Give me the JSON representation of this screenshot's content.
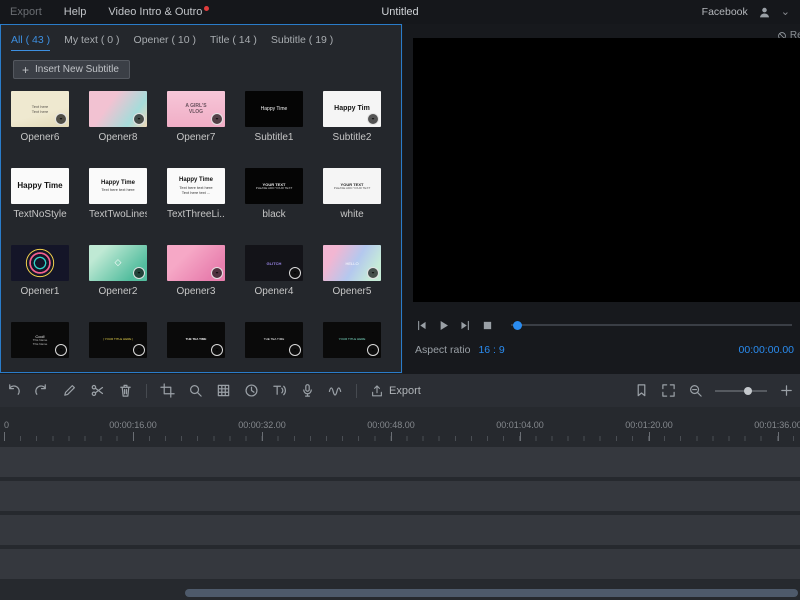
{
  "window": {
    "title": "Untitled"
  },
  "menubar": {
    "export": "Export",
    "help": "Help",
    "intro_outro": "Video Intro & Outro",
    "facebook": "Facebook"
  },
  "library": {
    "tabs": [
      {
        "label": "All ( 43 )",
        "active": true
      },
      {
        "label": "My text ( 0 )",
        "active": false
      },
      {
        "label": "Opener ( 10 )",
        "active": false
      },
      {
        "label": "Title ( 14 )",
        "active": false
      },
      {
        "label": "Subtitle ( 19 )",
        "active": false
      }
    ],
    "insert_button": "Insert New Subtitle",
    "templates": [
      {
        "label": "Opener6",
        "bg": "linear-gradient(165deg,#efe9d0 60%,#e3d9b6)",
        "lines": [
          {
            "t": "Text here",
            "c": "#55504a",
            "s": 4
          },
          {
            "t": "Text here",
            "c": "#55504a",
            "s": 4
          }
        ],
        "dl": true
      },
      {
        "label": "Opener8",
        "bg": "linear-gradient(125deg,#f2c2d2 35%,#a6dcda 75%,#f0d8b8)",
        "lines": [],
        "dl": true
      },
      {
        "label": "Opener7",
        "bg": "linear-gradient(180deg,#f7c6d8,#f0aec6)",
        "lines": [
          {
            "t": "A GIRL'S",
            "c": "#6a525e",
            "s": 5,
            "b": true
          },
          {
            "t": "VLOG",
            "c": "#6a525e",
            "s": 5,
            "b": true
          }
        ],
        "dl": true
      },
      {
        "label": "Subtitle1",
        "bg": "#050505",
        "lines": [
          {
            "t": "Happy Time",
            "c": "#f0f0f0",
            "s": 5
          }
        ],
        "dl": false
      },
      {
        "label": "Subtitle2",
        "bg": "#f5f5f5",
        "lines": [
          {
            "t": "Happy Tim",
            "c": "#111111",
            "s": 7,
            "b": true
          }
        ],
        "dl": true
      },
      {
        "label": "TextNoStyle",
        "bg": "#fafafa",
        "lines": [
          {
            "t": "Happy Time",
            "c": "#111111",
            "s": 8,
            "b": true
          }
        ],
        "dl": false
      },
      {
        "label": "TextTwoLines",
        "bg": "#fafafa",
        "lines": [
          {
            "t": "Happy Time",
            "c": "#111111",
            "s": 6,
            "b": true
          },
          {
            "t": "Text here text here",
            "c": "#333333",
            "s": 4
          }
        ],
        "dl": false
      },
      {
        "label": "TextThreeLi...",
        "bg": "#fafafa",
        "lines": [
          {
            "t": "Happy Time",
            "c": "#111111",
            "s": 6,
            "b": true
          },
          {
            "t": "Text here text here",
            "c": "#333333",
            "s": 4
          },
          {
            "t": "Text here text ...",
            "c": "#333333",
            "s": 4
          }
        ],
        "dl": false
      },
      {
        "label": "black",
        "bg": "#050505",
        "lines": [
          {
            "t": "YOUR TEXT",
            "c": "#f0f0f0",
            "s": 4,
            "b": true
          },
          {
            "t": "PLEASE ADD YOUR TEXT",
            "c": "#cfcfcf",
            "s": 3
          }
        ],
        "dl": false
      },
      {
        "label": "white",
        "bg": "#f5f5f5",
        "lines": [
          {
            "t": "YOUR TEXT",
            "c": "#222222",
            "s": 4,
            "b": true
          },
          {
            "t": "PLEASE ADD YOUR TEXT",
            "c": "#555555",
            "s": 3
          }
        ],
        "dl": false
      },
      {
        "label": "Opener1",
        "bg": "radial-gradient(circle at 50% 50%,#141528 0 14%,#2fd3c6 15% 18%,#141528 19% 26%,#f2608e 27% 31%,#141528 32% 38%,#e8c84a 39% 41%,#141528 42%)",
        "lines": [],
        "dl": false
      },
      {
        "label": "Opener2",
        "bg": "linear-gradient(135deg,#bfe9d4 20%,#53bd9e 80%)",
        "lines": [
          {
            "t": "◇",
            "c": "#ffffff",
            "s": 9
          }
        ],
        "dl": true
      },
      {
        "label": "Opener3",
        "bg": "linear-gradient(135deg,#f6a8c6 30%,#e87fae 80%)",
        "lines": [],
        "dl": true
      },
      {
        "label": "Opener4",
        "bg": "#131318",
        "lines": [
          {
            "t": "GLITCH",
            "c": "#9a86e8",
            "s": 4,
            "b": true
          }
        ],
        "dl": true
      },
      {
        "label": "Opener5",
        "bg": "linear-gradient(120deg,#f2b6d2 20%,#b4c8ee 55%,#c6ecd8 85%)",
        "lines": [
          {
            "t": "HELLO",
            "c": "#ffffff",
            "s": 4
          }
        ],
        "dl": true
      },
      {
        "label": "",
        "bg": "#0a0a0a",
        "lines": [
          {
            "t": "Cool!",
            "c": "#f0f0f0",
            "s": 4
          },
          {
            "t": "This Name",
            "c": "#bdbdbd",
            "s": 3
          },
          {
            "t": "This Name",
            "c": "#bdbdbd",
            "s": 3
          }
        ],
        "dl": true
      },
      {
        "label": "",
        "bg": "#0a0a0a",
        "lines": [
          {
            "t": "| YOUR TITLE HERE |",
            "c": "#e8d44c",
            "s": 3
          }
        ],
        "dl": true
      },
      {
        "label": "",
        "bg": "#0a0a0a",
        "lines": [
          {
            "t": "THE TEA TIME",
            "c": "#f0f0f0",
            "s": 3,
            "b": true
          }
        ],
        "dl": true
      },
      {
        "label": "",
        "bg": "#0a0a0a",
        "lines": [
          {
            "t": "THE TEA TIME",
            "c": "#f0f0f0",
            "s": 3
          }
        ],
        "dl": true
      },
      {
        "label": "",
        "bg": "#0a0a0a",
        "lines": [
          {
            "t": "YOUR TITLE HERE",
            "c": "#7ee0c8",
            "s": 3
          }
        ],
        "dl": true
      }
    ]
  },
  "preview": {
    "reset": "Reset",
    "aspect_label": "Aspect ratio",
    "aspect_value": "16 : 9",
    "timecode": "00:00:00.00"
  },
  "toolbar": {
    "left_icons": [
      "undo",
      "redo",
      "edit",
      "split",
      "delete",
      "divider",
      "crop",
      "zoom",
      "mosaic",
      "duration",
      "text-to-speech",
      "record",
      "voice-change",
      "divider"
    ],
    "export_label": "Export",
    "right_icons": [
      "marker",
      "fit-screen",
      "zoom-out",
      "slider",
      "zoom-in"
    ]
  },
  "playback": [
    "previous-frame",
    "play",
    "next-frame",
    "stop"
  ],
  "timeline": {
    "origin_label": "0",
    "time_labels": [
      "00:00:16.00",
      "00:00:32.00",
      "00:00:48.00",
      "00:01:04.00",
      "00:01:20.00",
      "00:01:36.00"
    ],
    "track_count": 4
  },
  "colors": {
    "accent": "#2a8cf0",
    "panel_border": "#2a7cc9",
    "notification": "#e03c3c"
  }
}
